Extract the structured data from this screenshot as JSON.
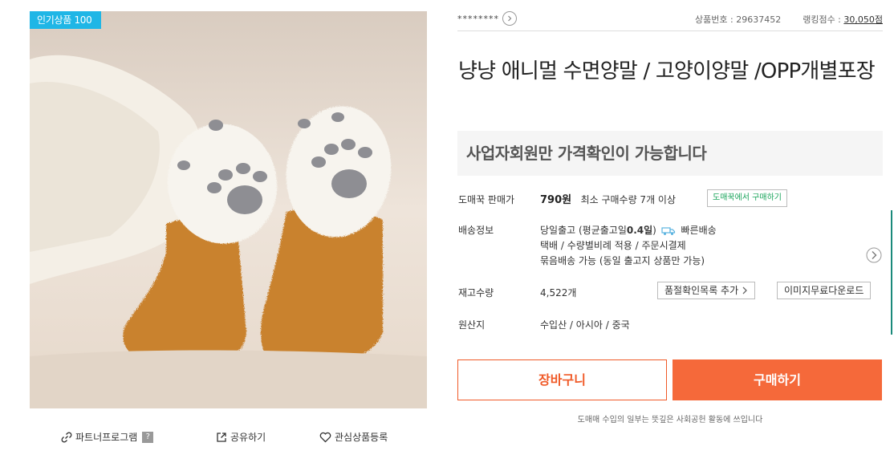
{
  "badge": "인기상품 100",
  "image_alt": "cat paw fuzzy socks",
  "actions": {
    "partner": "파트너프로그램",
    "partner_help": "?",
    "share": "공유하기",
    "wishlist": "관심상품등록"
  },
  "topbar": {
    "seller": "********",
    "product_no": "상품번호 : 29637452",
    "ranking_label": "랭킹점수 : ",
    "ranking_score": "30,050점"
  },
  "product": {
    "title": "냥냥 애니멀 수면양말 / 고양이양말 /OPP개별포장",
    "notice": "사업자회원만 가격확인이 가능합니다"
  },
  "price_row": {
    "label": "도매꾹 판매가",
    "price": "790원",
    "min_qty": "최소 구매수량 7개 이상",
    "buy_link": "도매꾹에서 구매하기"
  },
  "shipping": {
    "label": "배송정보",
    "line1_prefix": "당일출고 (평균출고일",
    "line1_days": "0.4일",
    "line1_suffix": ")",
    "fast": "빠른배송",
    "line2": "택배 / 수량별비례 적용 / 주문시결제",
    "line3": "묶음배송 가능 (동일 출고지 상품만 가능)"
  },
  "stock": {
    "label": "재고수량",
    "value": "4,522개",
    "restock_btn": "품절확인목록 추가",
    "image_btn": "이미지무료다운로드"
  },
  "origin": {
    "label": "원산지",
    "value": "수입산 / 아시아 / 중국"
  },
  "buttons": {
    "cart": "장바구니",
    "buy": "구매하기"
  },
  "footnote": "도매매 수입의 일부는 뜻깊은 사회공헌 활동에 쓰입니다",
  "colors": {
    "accent": "#f5693a",
    "badge": "#1fb6e6",
    "link_green": "#1aa45b",
    "sock_orange": "#c9822f"
  }
}
